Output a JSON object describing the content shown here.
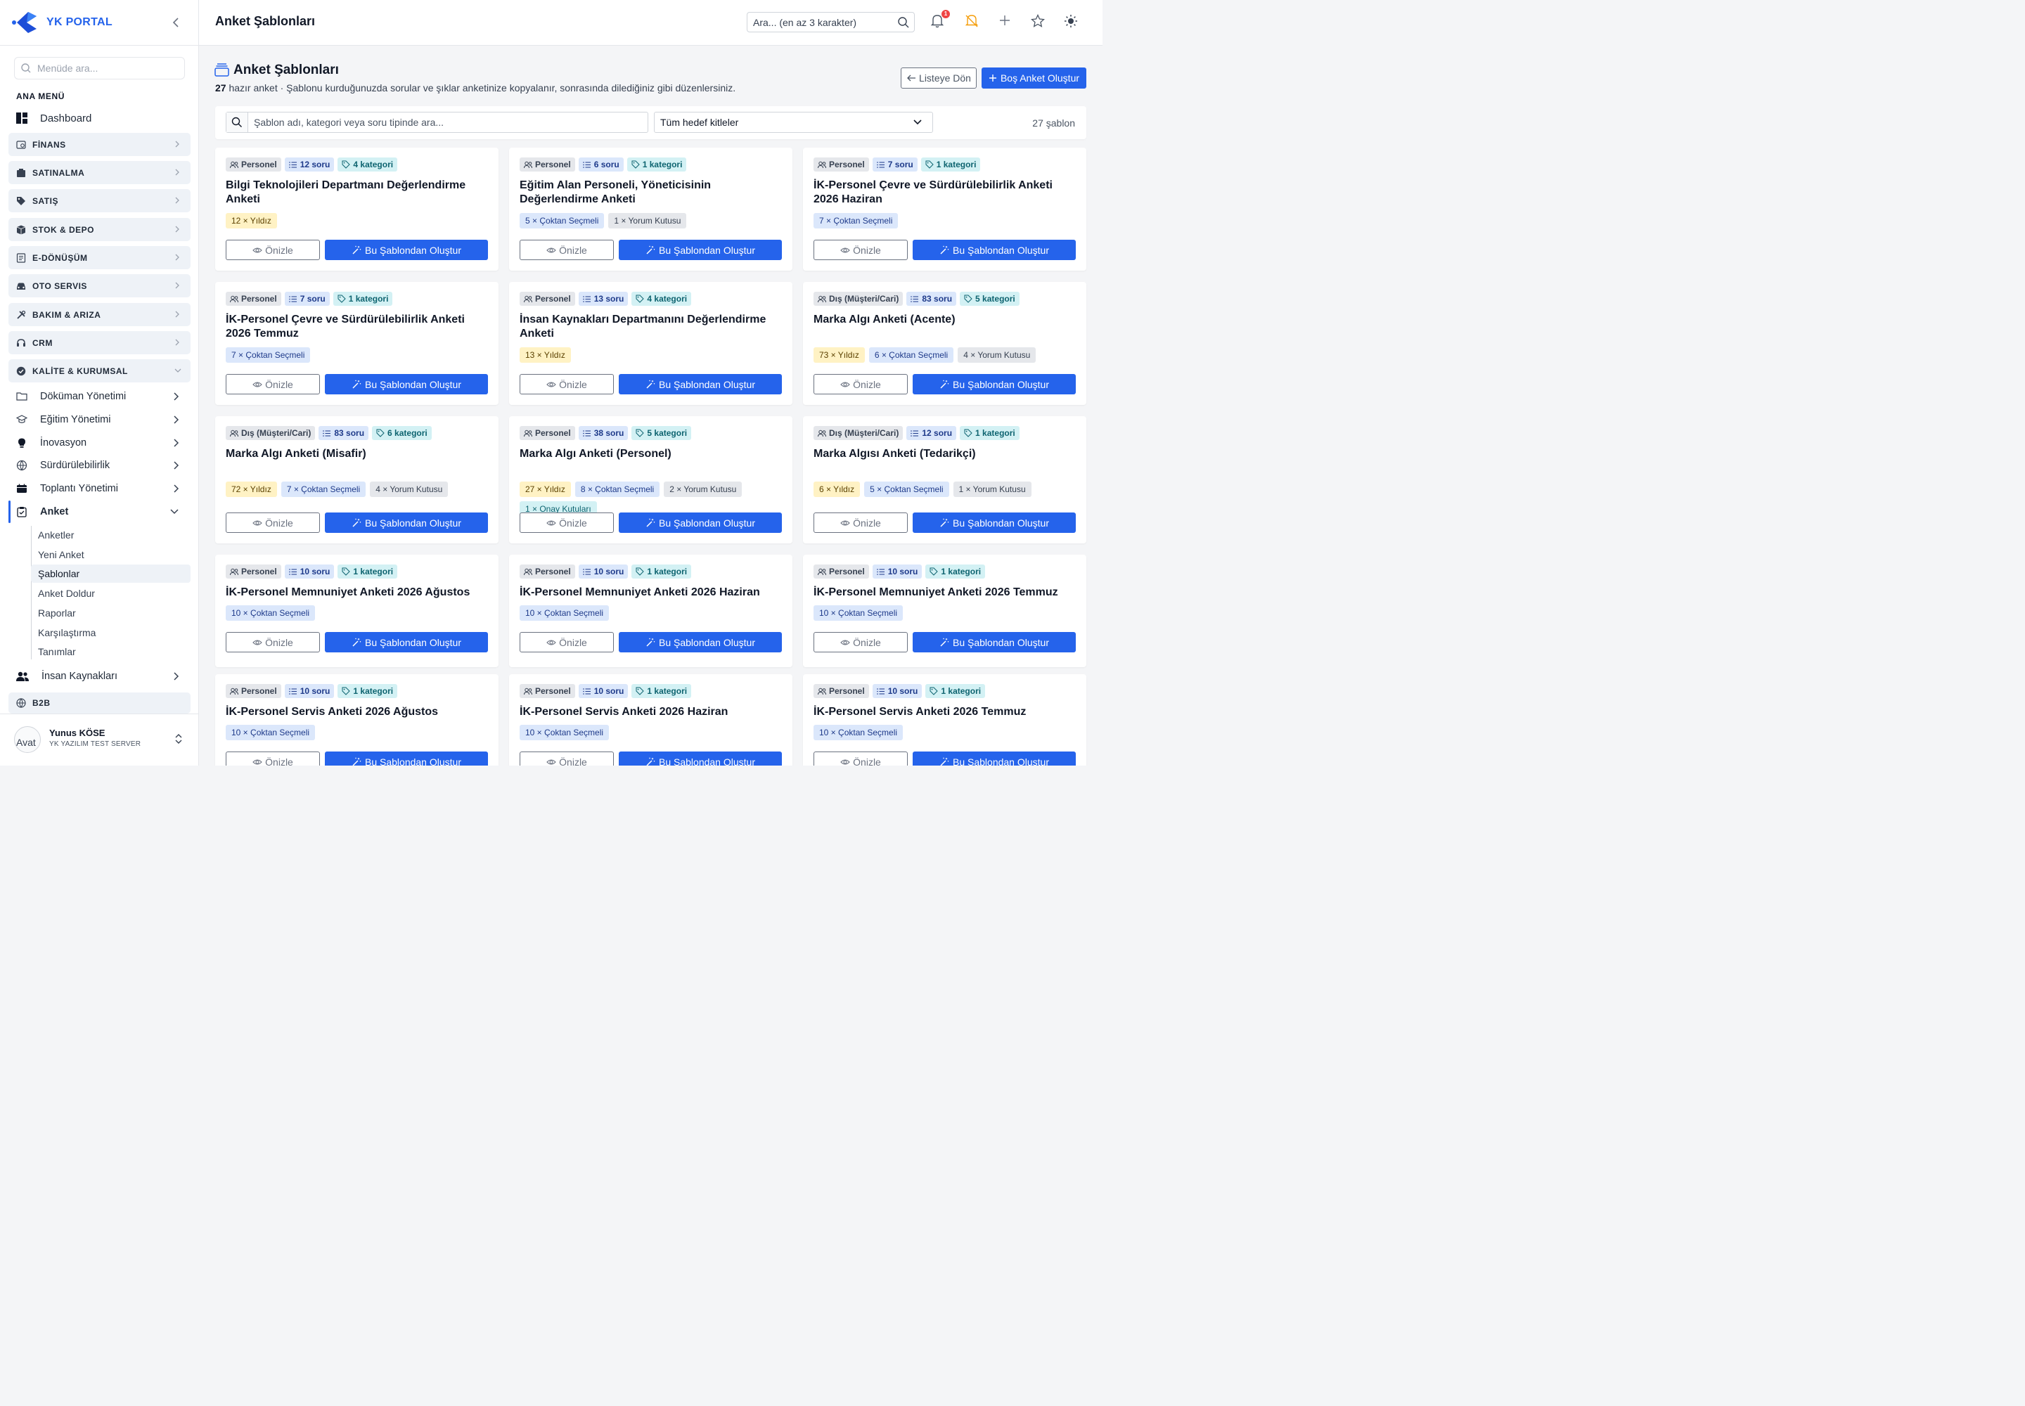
{
  "brand": {
    "name": "YK PORTAL",
    "accent": "#2563eb"
  },
  "sidebar": {
    "search_placeholder": "Menüde ara...",
    "section_title": "ANA MENÜ",
    "dashboard": "Dashboard",
    "groups": [
      {
        "label": "FİNANS",
        "icon": "finance-icon"
      },
      {
        "label": "SATINALMA",
        "icon": "purchase-icon"
      },
      {
        "label": "SATIŞ",
        "icon": "tag-icon"
      },
      {
        "label": "STOK & DEPO",
        "icon": "box-icon"
      },
      {
        "label": "E-DÖNÜŞÜM",
        "icon": "document-icon"
      },
      {
        "label": "OTO SERVIS",
        "icon": "car-icon"
      },
      {
        "label": "BAKIM & ARIZA",
        "icon": "tools-icon"
      },
      {
        "label": "CRM",
        "icon": "headset-icon"
      },
      {
        "label": "KALİTE & KURUMSAL",
        "icon": "shield-check-icon"
      }
    ],
    "sub_items": [
      {
        "label": "Döküman Yönetimi",
        "icon": "folder-icon"
      },
      {
        "label": "Eğitim Yönetimi",
        "icon": "graduation-cap-icon"
      },
      {
        "label": "İnovasyon",
        "icon": "lightbulb-icon"
      },
      {
        "label": "Sürdürülebilirlik",
        "icon": "globe-icon"
      },
      {
        "label": "Toplantı Yönetimi",
        "icon": "calendar-icon"
      },
      {
        "label": "Anket",
        "icon": "clipboard-icon"
      }
    ],
    "anket_children": [
      "Anketler",
      "Yeni Anket",
      "Şablonlar",
      "Anket Doldur",
      "Raporlar",
      "Karşılaştırma",
      "Tanımlar"
    ],
    "hr": "İnsan Kaynakları",
    "b2b": "B2B",
    "user": {
      "name": "Yunus KÖSE",
      "subtitle": "YK YAZILIM TEST SERVER",
      "avatar_alt": "Avat"
    }
  },
  "topbar": {
    "title": "Anket Şablonları",
    "search_placeholder": "Ara... (en az 3 karakter)",
    "notification_count": "1"
  },
  "page": {
    "title": "Anket Şablonları",
    "count": "27",
    "subtitle_rest": " hazır anket · Şablonu kurduğunuzda sorular ve şıklar anketinize kopyalanır, sonrasında dilediğiniz gibi düzenlersiniz.",
    "back_button": "Listeye Dön",
    "new_button": "Boş Anket Oluştur"
  },
  "filter": {
    "search_placeholder": "Şablon adı, kategori veya soru tipinde ara...",
    "audience_selected": "Tüm hedef kitleler",
    "count_text": "27 şablon"
  },
  "card_labels": {
    "preview": "Önizle",
    "use": "Bu Şablondan Oluştur"
  },
  "templates": [
    {
      "audience": "Personel",
      "questions": "12 soru",
      "categories": "4 kategori",
      "title": "Bilgi Teknolojileri Departmanı Değerlendirme Anketi",
      "chips": [
        {
          "text": "12 × Yıldız",
          "kind": "yildiz"
        }
      ]
    },
    {
      "audience": "Personel",
      "questions": "6 soru",
      "categories": "1 kategori",
      "title": "Eğitim Alan Personeli, Yöneticisinin Değerlendirme Anketi",
      "chips": [
        {
          "text": "5 × Çoktan Seçmeli",
          "kind": "coktan"
        },
        {
          "text": "1 × Yorum Kutusu",
          "kind": "yorum"
        }
      ]
    },
    {
      "audience": "Personel",
      "questions": "7 soru",
      "categories": "1 kategori",
      "title": "İK-Personel Çevre ve Sürdürülebilirlik Anketi 2026 Haziran",
      "chips": [
        {
          "text": "7 × Çoktan Seçmeli",
          "kind": "coktan"
        }
      ]
    },
    {
      "audience": "Personel",
      "questions": "7 soru",
      "categories": "1 kategori",
      "title": "İK-Personel Çevre ve Sürdürülebilirlik Anketi 2026 Temmuz",
      "chips": [
        {
          "text": "7 × Çoktan Seçmeli",
          "kind": "coktan"
        }
      ]
    },
    {
      "audience": "Personel",
      "questions": "13 soru",
      "categories": "4 kategori",
      "title": "İnsan Kaynakları Departmanını Değerlendirme Anketi",
      "chips": [
        {
          "text": "13 × Yıldız",
          "kind": "yildiz"
        }
      ]
    },
    {
      "audience": "Dış (Müşteri/Cari)",
      "questions": "83 soru",
      "categories": "5 kategori",
      "title": "Marka Algı Anketi (Acente)",
      "chips": [
        {
          "text": "73 × Yıldız",
          "kind": "yildiz"
        },
        {
          "text": "6 × Çoktan Seçmeli",
          "kind": "coktan"
        },
        {
          "text": "4 × Yorum Kutusu",
          "kind": "yorum"
        }
      ]
    },
    {
      "audience": "Dış (Müşteri/Cari)",
      "questions": "83 soru",
      "categories": "6 kategori",
      "title": "Marka Algı Anketi (Misafir)",
      "chips": [
        {
          "text": "72 × Yıldız",
          "kind": "yildiz"
        },
        {
          "text": "7 × Çoktan Seçmeli",
          "kind": "coktan"
        },
        {
          "text": "4 × Yorum Kutusu",
          "kind": "yorum"
        }
      ]
    },
    {
      "audience": "Personel",
      "questions": "38 soru",
      "categories": "5 kategori",
      "title": "Marka Algı Anketi (Personel)",
      "chips": [
        {
          "text": "27 × Yıldız",
          "kind": "yildiz"
        },
        {
          "text": "8 × Çoktan Seçmeli",
          "kind": "coktan"
        },
        {
          "text": "2 × Yorum Kutusu",
          "kind": "yorum"
        },
        {
          "text": "1 × Onay Kutuları",
          "kind": "onay"
        }
      ]
    },
    {
      "audience": "Dış (Müşteri/Cari)",
      "questions": "12 soru",
      "categories": "1 kategori",
      "title": "Marka Algısı Anketi (Tedarikçi)",
      "chips": [
        {
          "text": "6 × Yıldız",
          "kind": "yildiz"
        },
        {
          "text": "5 × Çoktan Seçmeli",
          "kind": "coktan"
        },
        {
          "text": "1 × Yorum Kutusu",
          "kind": "yorum"
        }
      ]
    },
    {
      "audience": "Personel",
      "questions": "10 soru",
      "categories": "1 kategori",
      "title": "İK-Personel Memnuniyet Anketi 2026 Ağustos",
      "chips": [
        {
          "text": "10 × Çoktan Seçmeli",
          "kind": "coktan"
        }
      ]
    },
    {
      "audience": "Personel",
      "questions": "10 soru",
      "categories": "1 kategori",
      "title": "İK-Personel Memnuniyet Anketi 2026 Haziran",
      "chips": [
        {
          "text": "10 × Çoktan Seçmeli",
          "kind": "coktan"
        }
      ]
    },
    {
      "audience": "Personel",
      "questions": "10 soru",
      "categories": "1 kategori",
      "title": "İK-Personel Memnuniyet Anketi 2026 Temmuz",
      "chips": [
        {
          "text": "10 × Çoktan Seçmeli",
          "kind": "coktan"
        }
      ]
    },
    {
      "audience": "Personel",
      "questions": "10 soru",
      "categories": "1 kategori",
      "title": "İK-Personel Servis Anketi 2026 Ağustos",
      "chips": [
        {
          "text": "10 × Çoktan Seçmeli",
          "kind": "coktan"
        }
      ]
    },
    {
      "audience": "Personel",
      "questions": "10 soru",
      "categories": "1 kategori",
      "title": "İK-Personel Servis Anketi 2026 Haziran",
      "chips": [
        {
          "text": "10 × Çoktan Seçmeli",
          "kind": "coktan"
        }
      ]
    },
    {
      "audience": "Personel",
      "questions": "10 soru",
      "categories": "1 kategori",
      "title": "İK-Personel Servis Anketi 2026 Temmuz",
      "chips": [
        {
          "text": "10 × Çoktan Seçmeli",
          "kind": "coktan"
        }
      ]
    }
  ]
}
